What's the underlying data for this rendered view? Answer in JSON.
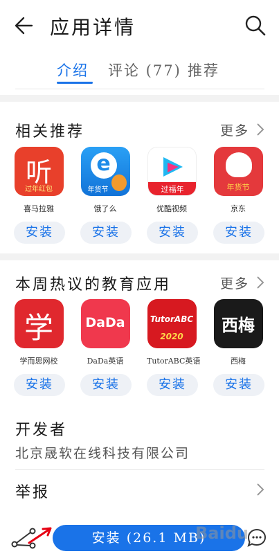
{
  "header": {
    "title": "应用详情",
    "back_icon": "arrow-left-icon",
    "search_icon": "search-icon"
  },
  "tabs": [
    {
      "label": "介绍",
      "active": true
    },
    {
      "label": "评论 (77)",
      "active": false
    },
    {
      "label": "推荐",
      "active": false
    }
  ],
  "related": {
    "title": "相关推荐",
    "more": "更多",
    "apps": [
      {
        "name": "喜马拉雅",
        "install": "安装",
        "icon_text": "听",
        "badge": "过年红包"
      },
      {
        "name": "饿了么",
        "install": "安装",
        "icon_text": "e",
        "badge": "年货节"
      },
      {
        "name": "优酷视频",
        "install": "安装",
        "icon_text": "",
        "badge": "过福年"
      },
      {
        "name": "京东",
        "install": "安装",
        "icon_text": "",
        "badge": "年货节"
      }
    ]
  },
  "hot": {
    "title": "本周热议的教育应用",
    "more": "更多",
    "apps": [
      {
        "name": "学而思网校",
        "install": "安装",
        "icon_text": "学"
      },
      {
        "name": "DaDa英语",
        "install": "安装",
        "icon_text": "DaDa"
      },
      {
        "name": "TutorABC英语",
        "install": "安装",
        "icon_text": "TutorABC",
        "badge": "2020"
      },
      {
        "name": "西梅",
        "install": "安装",
        "icon_text": "西梅"
      }
    ]
  },
  "developer": {
    "title": "开发者",
    "name": "北京晟软在线科技有限公司"
  },
  "report": {
    "label": "举报"
  },
  "bottom": {
    "install_label": "安装 (26.1 MB)",
    "share_icon": "share-icon",
    "comment_icon": "comment-icon"
  },
  "watermark": "Baidu",
  "colors": {
    "accent": "#1a73e8",
    "ximalaya": "#e8402b",
    "eleme": "#1e8be8",
    "youku": "#1fb8f2",
    "jd": "#e4393c",
    "xueersi": "#e0282e",
    "dada": "#f0384d",
    "tutorabc": "#d71920",
    "ximei": "#1a1a1a"
  }
}
